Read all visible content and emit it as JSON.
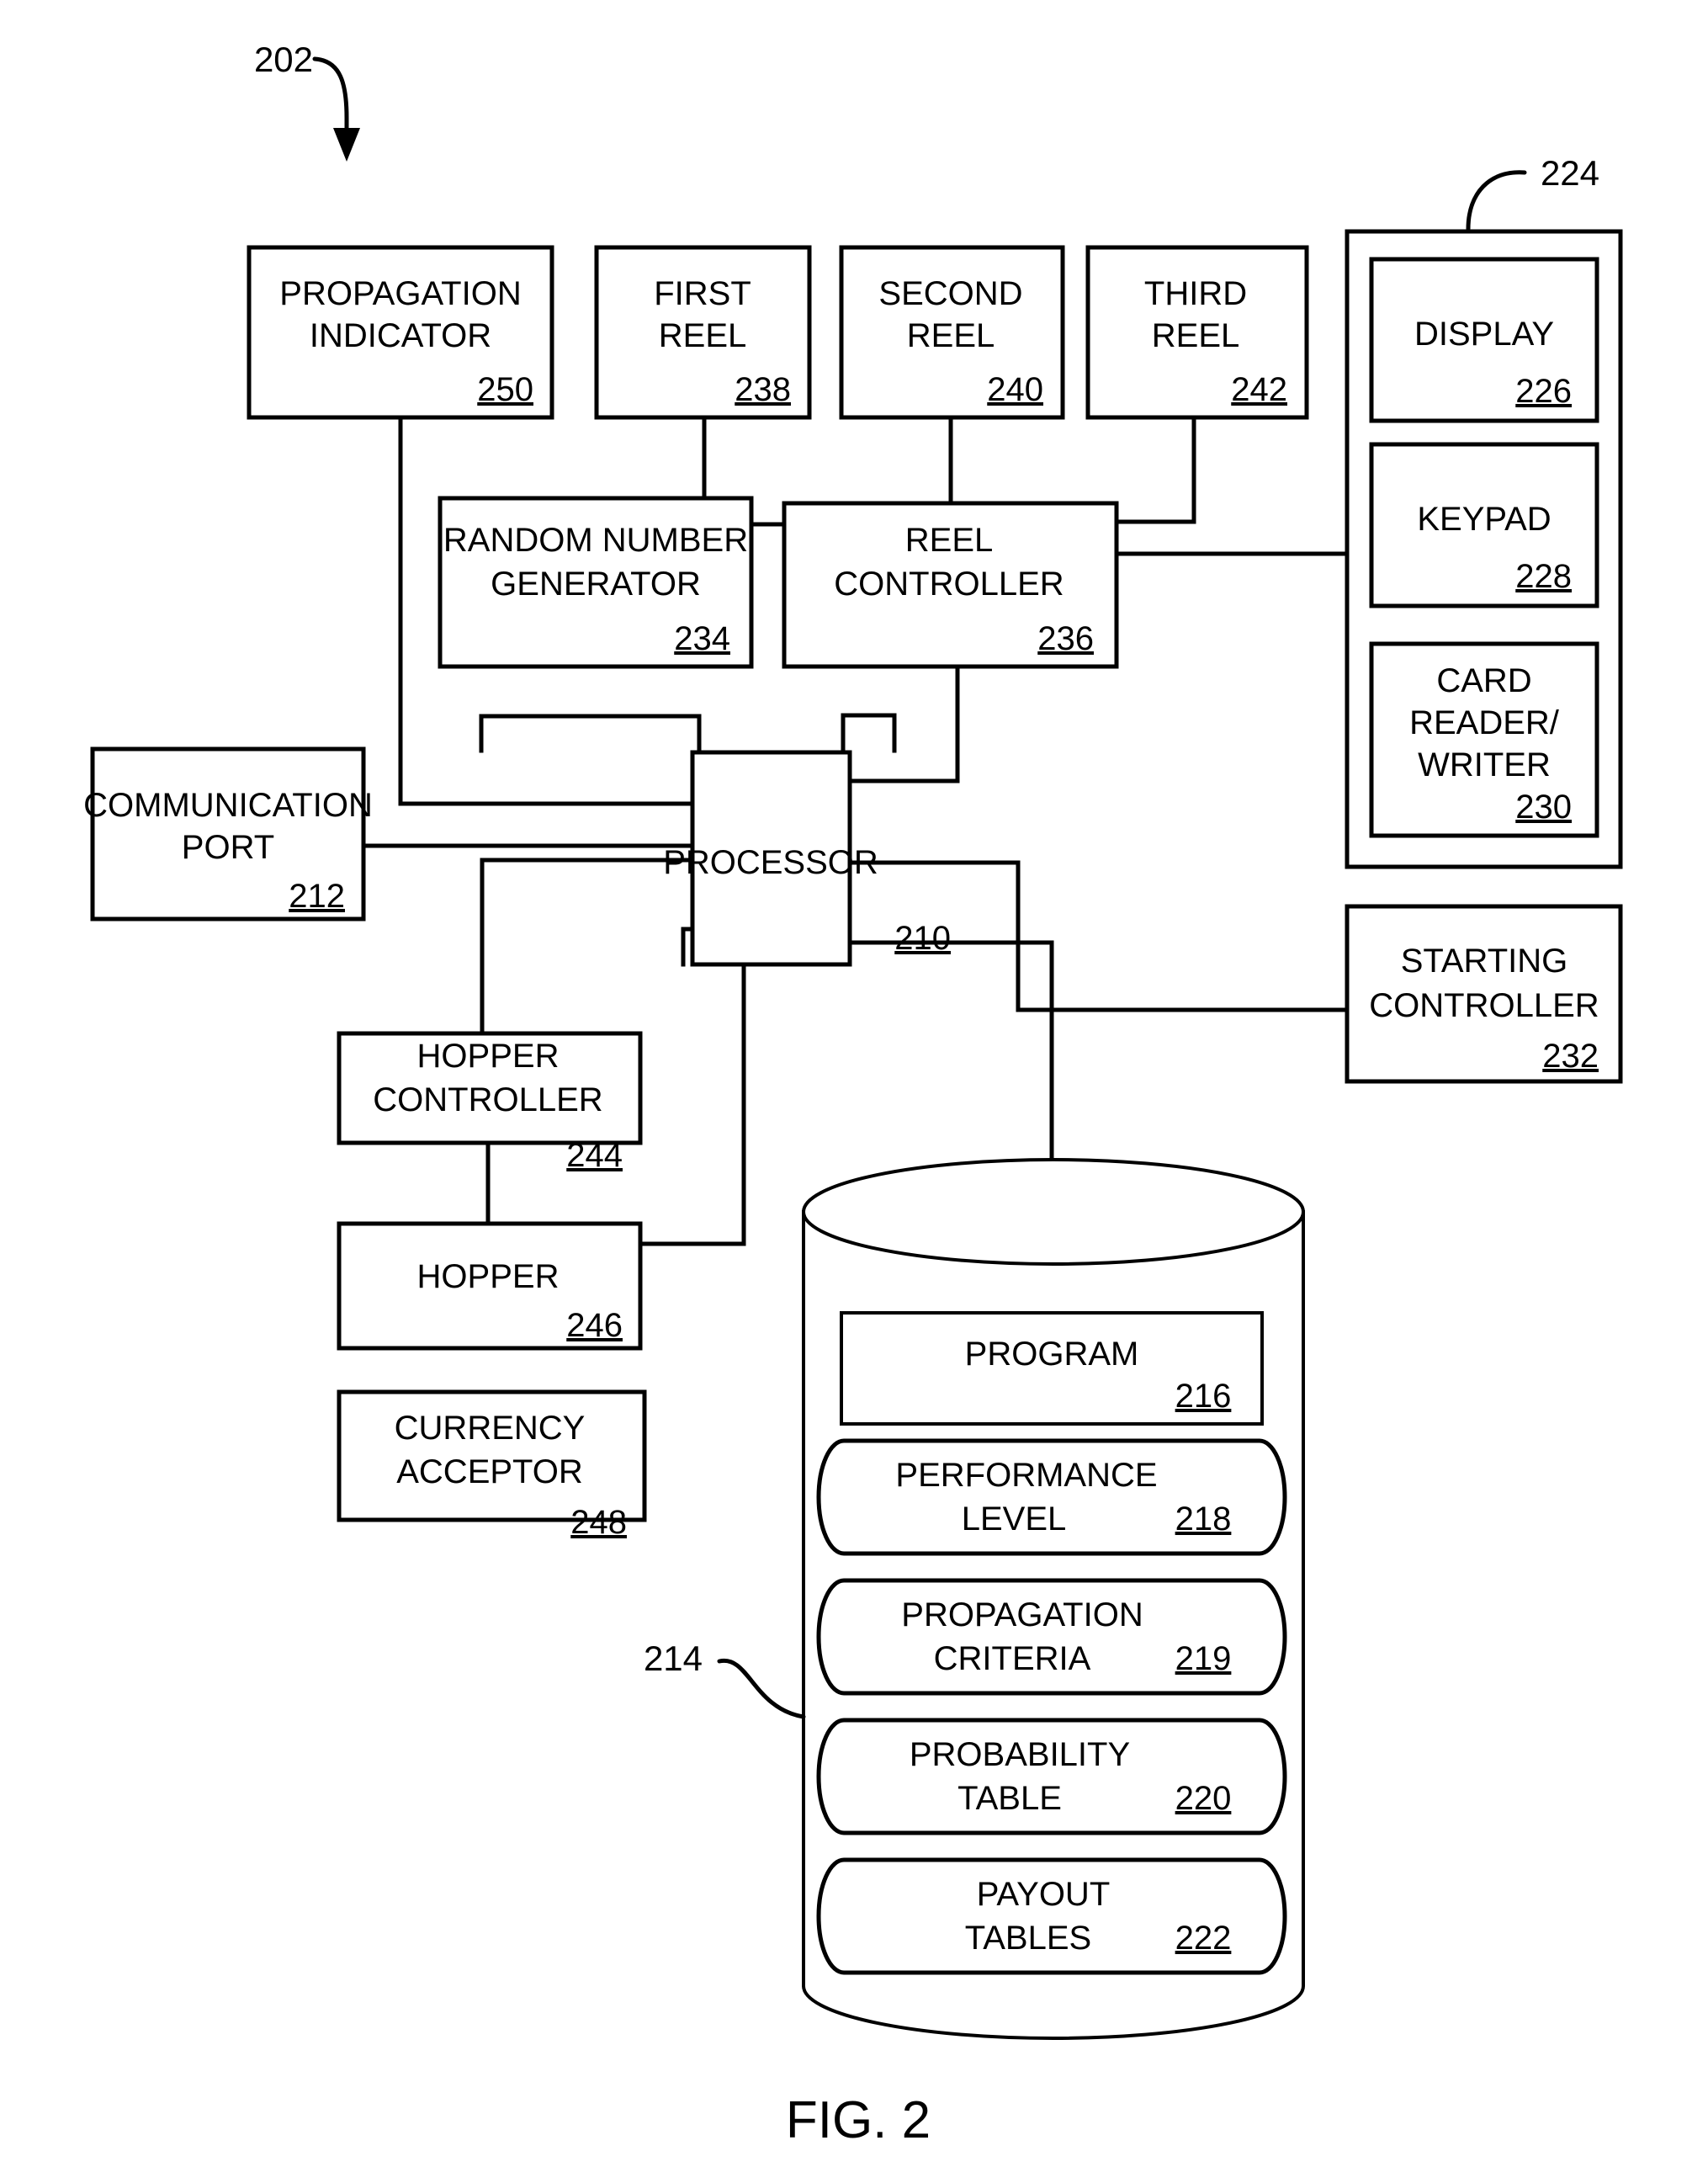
{
  "figure": {
    "caption": "FIG. 2",
    "system_ref": "202",
    "terminal_group_ref": "224",
    "database_ref": "214"
  },
  "blocks": {
    "propagation_indicator": {
      "line1": "PROPAGATION",
      "line2": "INDICATOR",
      "num": "250"
    },
    "first_reel": {
      "line1": "FIRST",
      "line2": "REEL",
      "num": "238"
    },
    "second_reel": {
      "line1": "SECOND",
      "line2": "REEL",
      "num": "240"
    },
    "third_reel": {
      "line1": "THIRD",
      "line2": "REEL",
      "num": "242"
    },
    "random_number_generator": {
      "line1": "RANDOM NUMBER",
      "line2": "GENERATOR",
      "num": "234"
    },
    "reel_controller": {
      "line1": "REEL",
      "line2": "CONTROLLER",
      "num": "236"
    },
    "communication_port": {
      "line1": "COMMUNICATION",
      "line2": "PORT",
      "num": "212"
    },
    "processor": {
      "line1": "PROCESSOR",
      "num": "210"
    },
    "hopper_controller": {
      "line1": "HOPPER",
      "line2": "CONTROLLER",
      "num": "244"
    },
    "hopper": {
      "line1": "HOPPER",
      "num": "246"
    },
    "currency_acceptor": {
      "line1": "CURRENCY",
      "line2": "ACCEPTOR",
      "num": "248"
    },
    "starting_controller": {
      "line1": "STARTING",
      "line2": "CONTROLLER",
      "num": "232"
    },
    "display": {
      "line1": "DISPLAY",
      "num": "226"
    },
    "keypad": {
      "line1": "KEYPAD",
      "num": "228"
    },
    "card_reader_writer": {
      "line1": "CARD",
      "line2": "READER/",
      "line3": "WRITER",
      "num": "230"
    }
  },
  "database": {
    "program": {
      "line1": "PROGRAM",
      "num": "216"
    },
    "performance_level": {
      "line1": "PERFORMANCE",
      "line2": "LEVEL",
      "num": "218"
    },
    "propagation_criteria": {
      "line1": "PROPAGATION",
      "line2": "CRITERIA",
      "num": "219"
    },
    "probability_table": {
      "line1": "PROBABILITY",
      "line2": "TABLE",
      "num": "220"
    },
    "payout_tables": {
      "line1": "PAYOUT",
      "line2": "TABLES",
      "num": "222"
    }
  }
}
